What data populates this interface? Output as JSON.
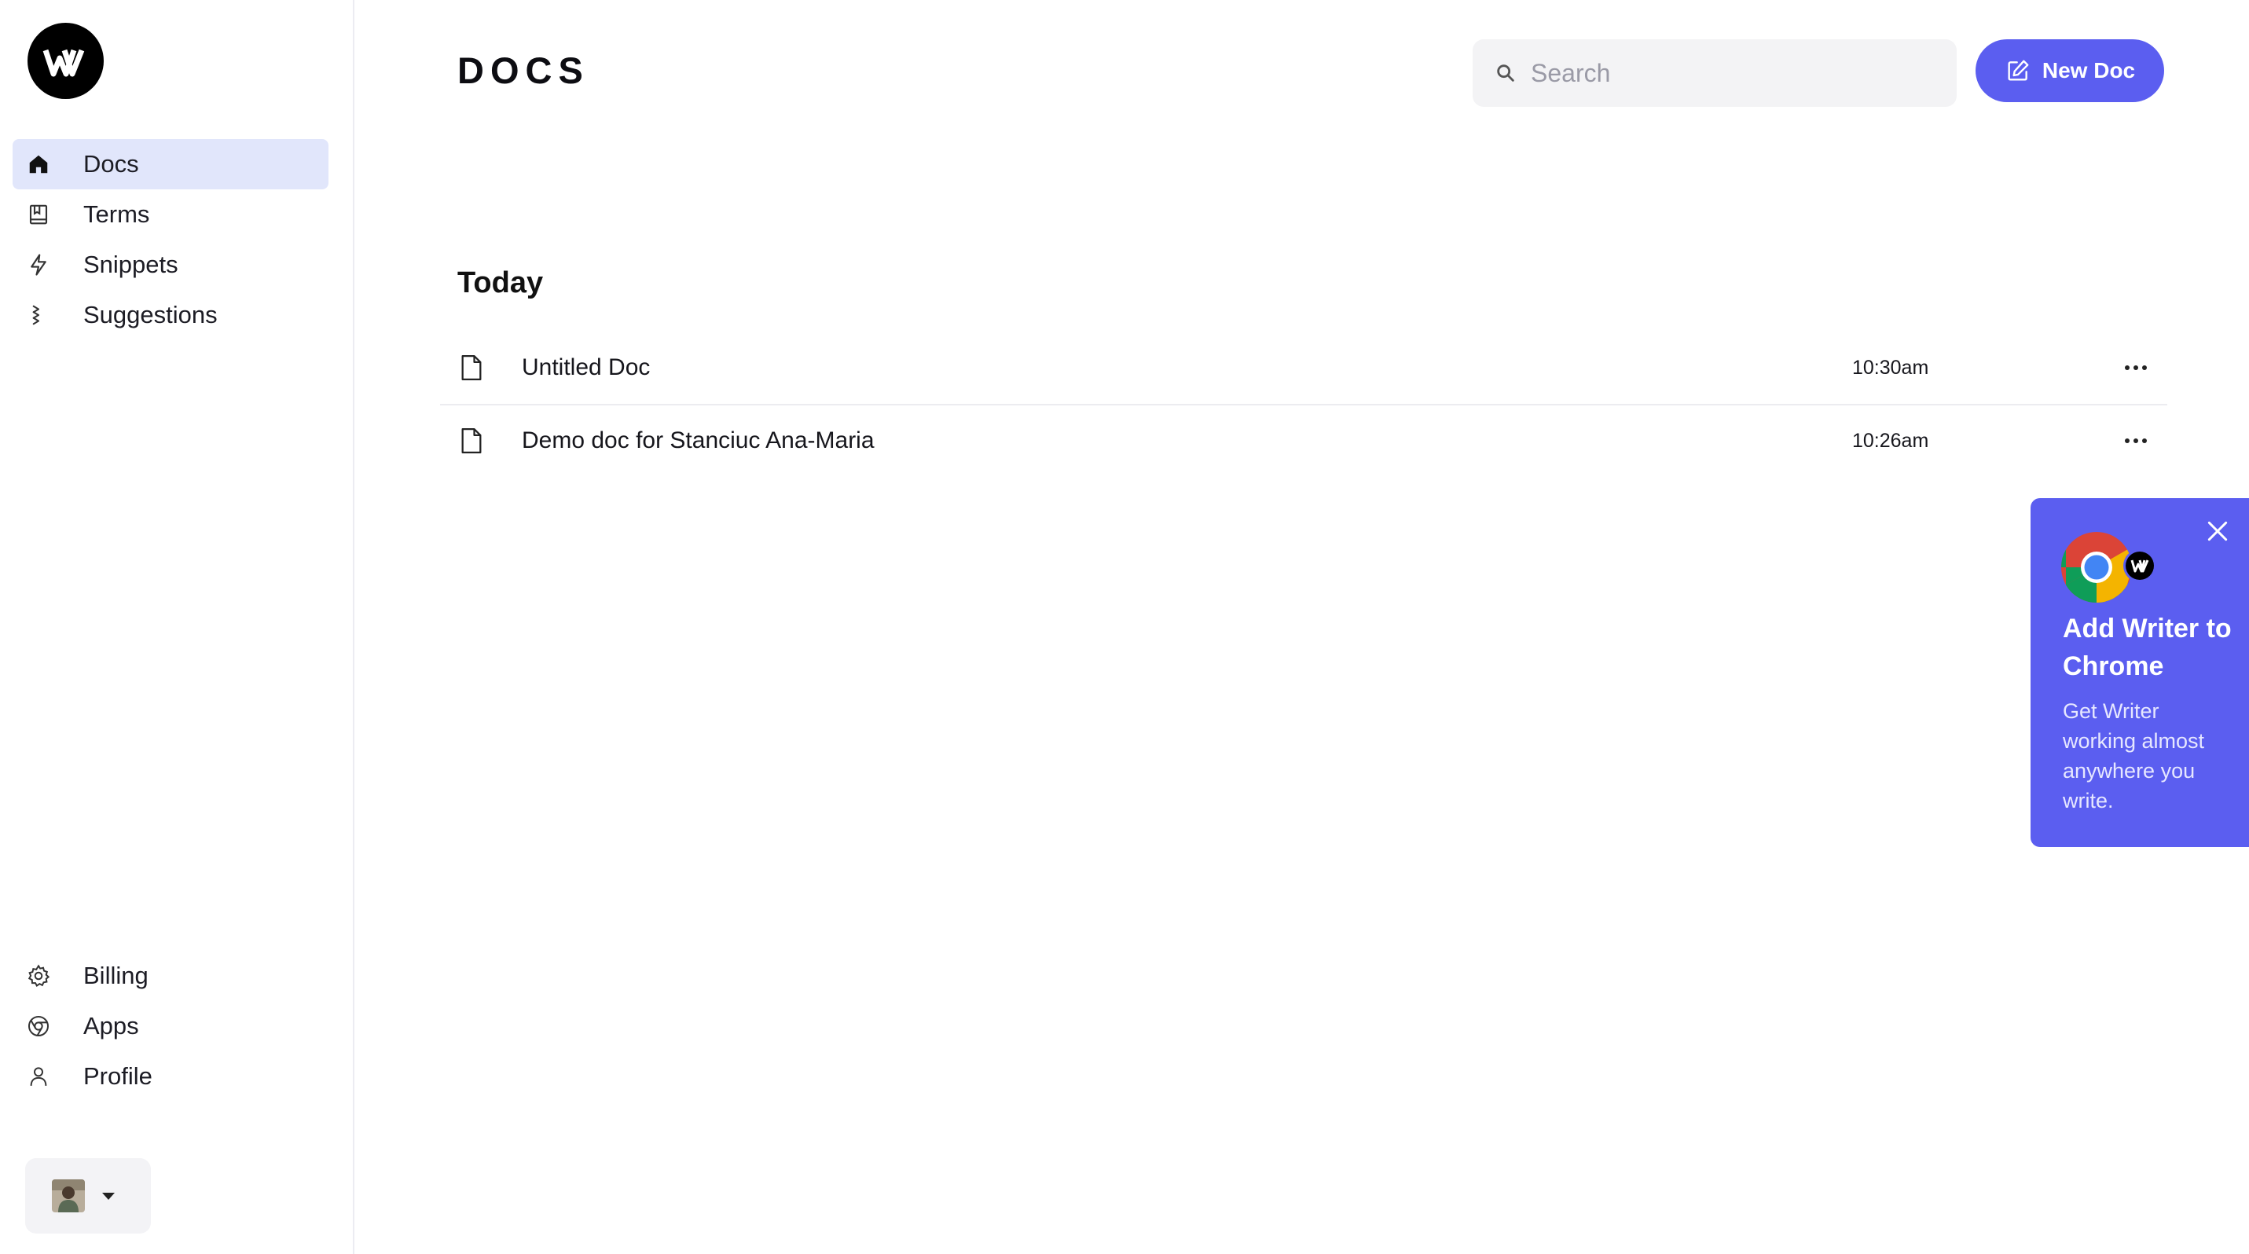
{
  "sidebar": {
    "nav_top": [
      {
        "label": "Docs",
        "icon": "home-icon",
        "active": true
      },
      {
        "label": "Terms",
        "icon": "book-icon",
        "active": false
      },
      {
        "label": "Snippets",
        "icon": "bolt-icon",
        "active": false
      },
      {
        "label": "Suggestions",
        "icon": "double-check-icon",
        "active": false
      }
    ],
    "nav_bottom": [
      {
        "label": "Billing",
        "icon": "gear-icon"
      },
      {
        "label": "Apps",
        "icon": "chrome-outline-icon"
      },
      {
        "label": "Profile",
        "icon": "user-icon"
      }
    ]
  },
  "header": {
    "title": "DOCS",
    "search_placeholder": "Search",
    "new_doc_label": "New Doc"
  },
  "section": {
    "title": "Today",
    "docs": [
      {
        "name": "Untitled Doc",
        "time": "10:30am"
      },
      {
        "name": "Demo doc for Stanciuc Ana-Maria",
        "time": "10:26am"
      }
    ]
  },
  "promo": {
    "title": "Add Writer to Chrome",
    "body": "Get Writer working almost anywhere you write."
  },
  "colors": {
    "accent": "#5b5ef0",
    "active_nav_bg": "#e1e6fb",
    "logo_bg": "#000000"
  }
}
